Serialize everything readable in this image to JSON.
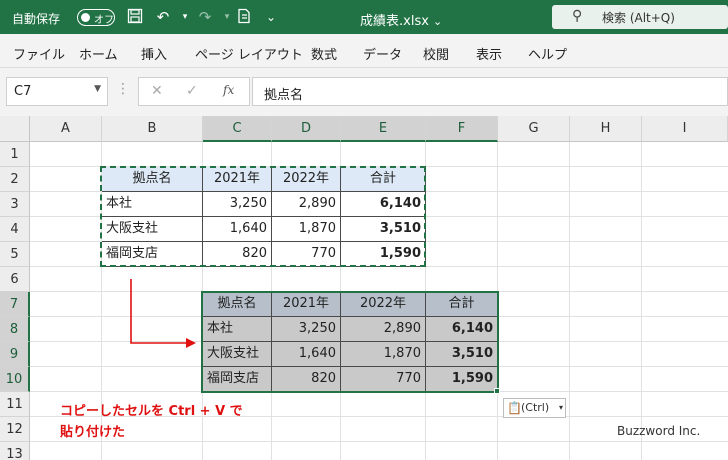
{
  "titlebar": {
    "autosave_label": "自動保存",
    "toggle_label": "オフ",
    "file_title": "成績表.xlsx",
    "search_placeholder": "検索 (Alt+Q)"
  },
  "menu": {
    "items": [
      "ファイル",
      "ホーム",
      "挿入",
      "ページ レイアウト",
      "数式",
      "データ",
      "校閲",
      "表示",
      "ヘルプ"
    ]
  },
  "formula_bar": {
    "name_box": "C7",
    "fx": "fx",
    "value": "拠点名"
  },
  "grid": {
    "columns": [
      "A",
      "B",
      "C",
      "D",
      "E",
      "F",
      "G",
      "H",
      "I"
    ],
    "rows": [
      "1",
      "2",
      "3",
      "4",
      "5",
      "6",
      "7",
      "8",
      "9",
      "10",
      "11",
      "12",
      "13"
    ]
  },
  "source_table": {
    "headers": [
      "拠点名",
      "2021年",
      "2022年",
      "合計"
    ],
    "rows": [
      [
        "本社",
        "3,250",
        "2,890",
        "6,140"
      ],
      [
        "大阪支社",
        "1,640",
        "1,870",
        "3,510"
      ],
      [
        "福岡支店",
        "820",
        "770",
        "1,590"
      ]
    ]
  },
  "pasted_table": {
    "headers": [
      "拠点名",
      "2021年",
      "2022年",
      "合計"
    ],
    "rows": [
      [
        "本社",
        "3,250",
        "2,890",
        "6,140"
      ],
      [
        "大阪支社",
        "1,640",
        "1,870",
        "3,510"
      ],
      [
        "福岡支店",
        "820",
        "770",
        "1,590"
      ]
    ]
  },
  "annotation": {
    "line1": "コピーしたセルを Ctrl + V で",
    "line2": "貼り付けた"
  },
  "paste_options": {
    "label": "(Ctrl)"
  },
  "credit": "Buzzword Inc.",
  "colors": {
    "accent": "#217346",
    "arrow": "#e01010"
  }
}
